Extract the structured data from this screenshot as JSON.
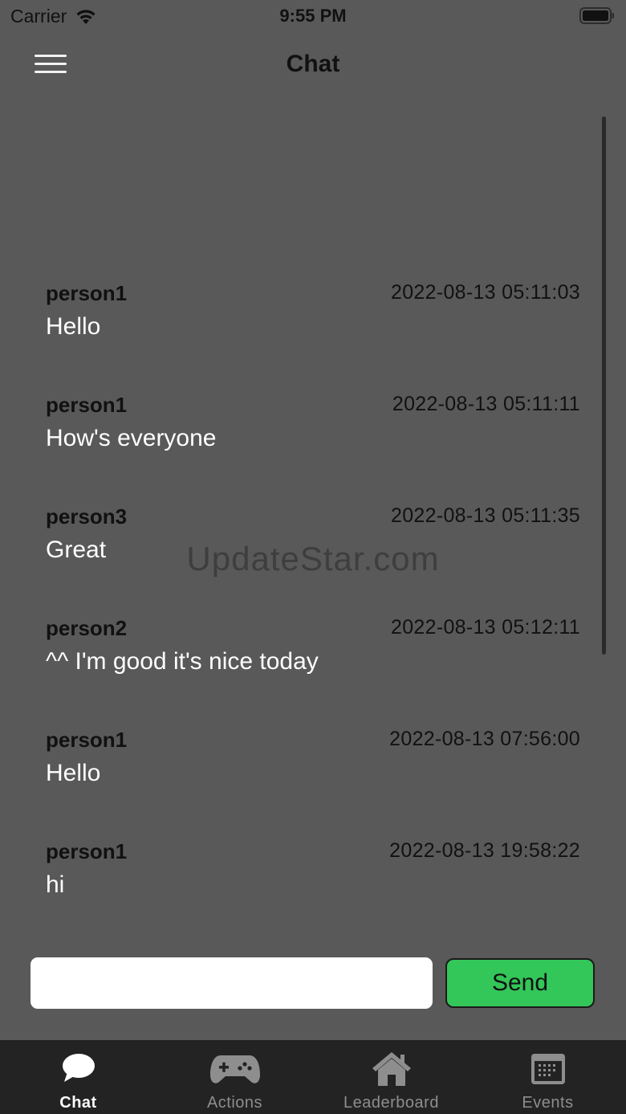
{
  "status_bar": {
    "carrier": "Carrier",
    "time": "9:55 PM"
  },
  "nav": {
    "title": "Chat"
  },
  "messages": [
    {
      "user": "person1",
      "time": "2022-08-13 05:11:03",
      "text": "Hello"
    },
    {
      "user": "person1",
      "time": "2022-08-13 05:11:11",
      "text": "How's everyone"
    },
    {
      "user": "person3",
      "time": "2022-08-13 05:11:35",
      "text": "Great"
    },
    {
      "user": "person2",
      "time": "2022-08-13 05:12:11",
      "text": "^^ I'm good it's nice today"
    },
    {
      "user": "person1",
      "time": "2022-08-13 07:56:00",
      "text": "Hello"
    },
    {
      "user": "person1",
      "time": "2022-08-13 19:58:22",
      "text": "hi"
    }
  ],
  "watermark": "UpdateStar.com",
  "composer": {
    "input_value": "",
    "send_label": "Send"
  },
  "tabs": [
    {
      "label": "Chat",
      "icon": "chat-bubble-icon",
      "active": true
    },
    {
      "label": "Actions",
      "icon": "gamepad-icon",
      "active": false
    },
    {
      "label": "Leaderboard",
      "icon": "house-icon",
      "active": false
    },
    {
      "label": "Events",
      "icon": "calendar-icon",
      "active": false
    }
  ],
  "colors": {
    "background": "#595959",
    "send_button": "#33c659",
    "tab_bar": "#232323",
    "tab_active": "#ffffff",
    "tab_inactive": "#8e8e8e"
  }
}
